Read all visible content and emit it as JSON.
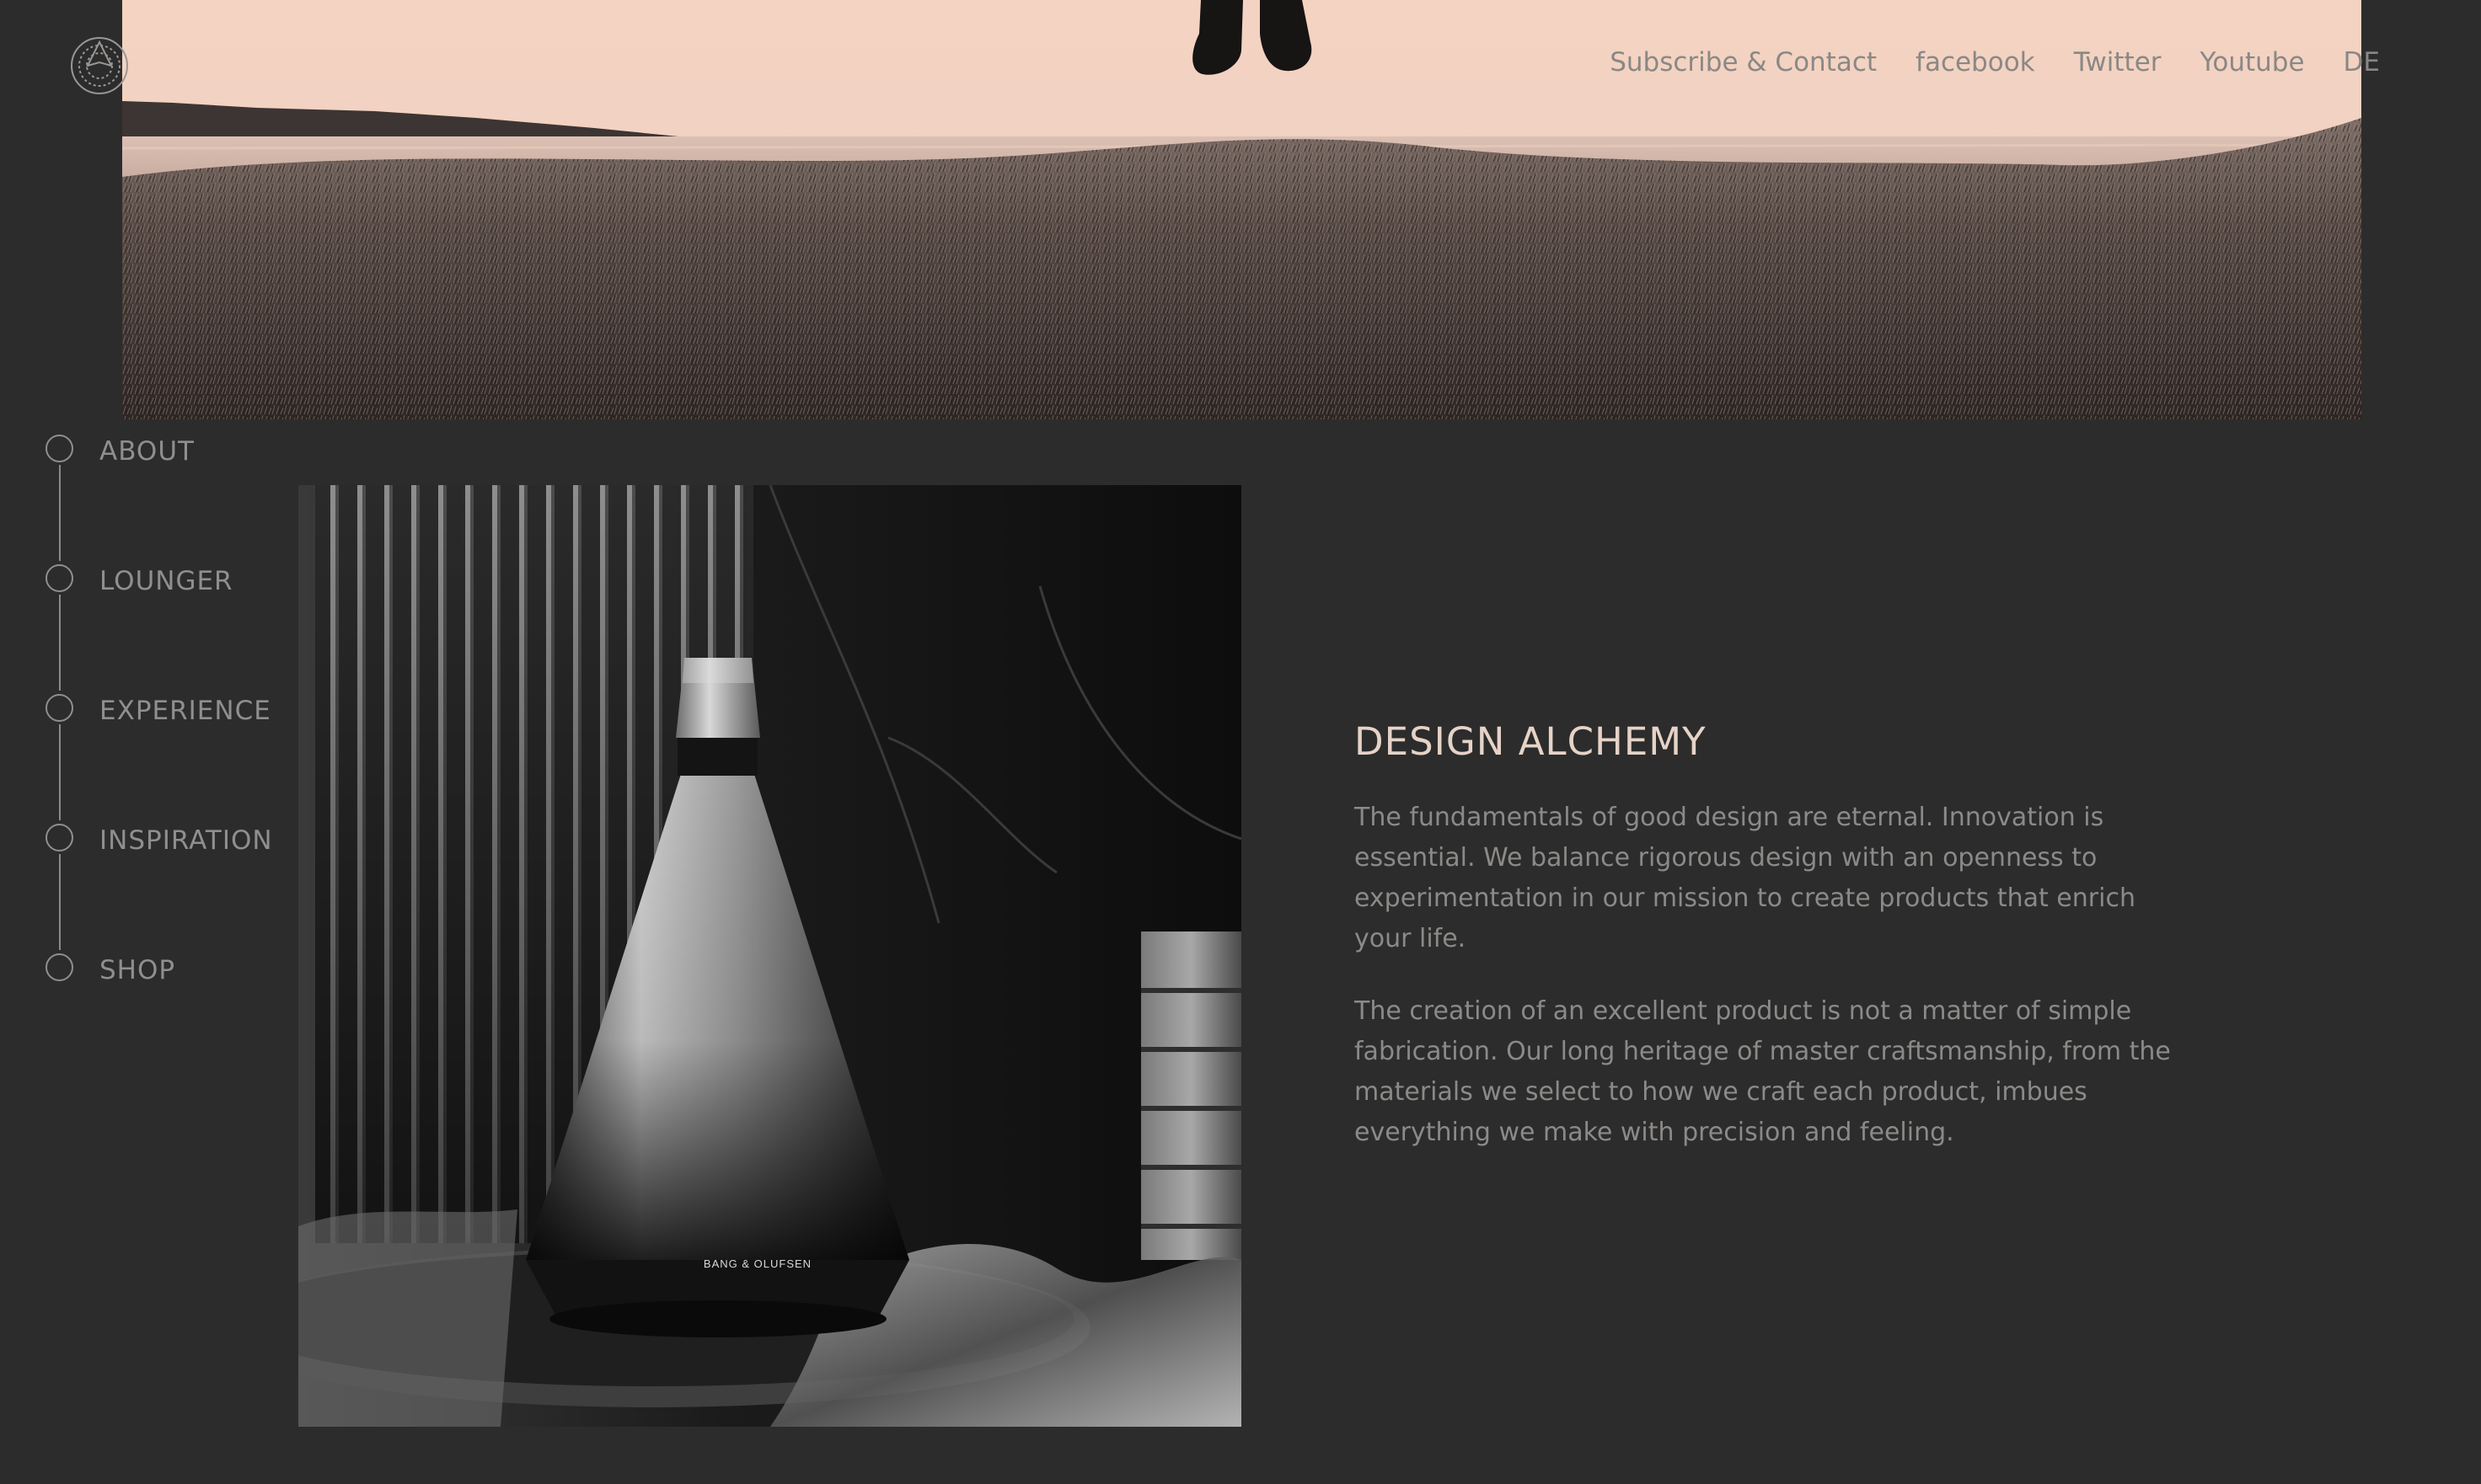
{
  "header": {
    "logo_icon": "brand-emblem-icon",
    "nav": [
      {
        "label": "Subscribe & Contact"
      },
      {
        "label": "facebook"
      },
      {
        "label": "Twitter"
      },
      {
        "label": "Youtube"
      },
      {
        "label": "DE"
      }
    ]
  },
  "side_nav": {
    "items": [
      {
        "label": "ABOUT"
      },
      {
        "label": "LOUNGER"
      },
      {
        "label": "EXPERIENCE"
      },
      {
        "label": "INSPIRATION"
      },
      {
        "label": "SHOP"
      }
    ]
  },
  "product_image": {
    "brand_text": "BANG & OLUFSEN"
  },
  "content": {
    "title": "DESIGN ALCHEMY",
    "paragraphs": [
      "The fundamentals of good design are eternal. Innovation is essential. We balance rigorous design with an openness to experimentation in our mission to create products that enrich your life.",
      "The creation of an excellent product is not a matter of simple fabrication. Our long heritage of master craftsmanship, from the materials we select to how we craft each product, imbues everything we make with precision and feeling."
    ]
  },
  "colors": {
    "background": "#2c2c2c",
    "title": "#e6d3c7",
    "body_text": "#8c8a88",
    "nav_text": "#8a8885",
    "sky": "#f2d4c3"
  }
}
